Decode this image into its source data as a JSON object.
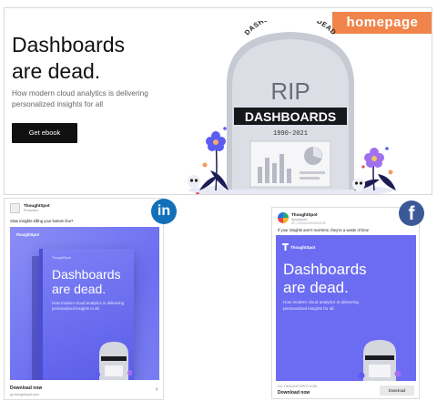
{
  "homepage": {
    "tag": "homepage",
    "headline_line1": "Dashboards",
    "headline_line2": "are dead.",
    "subtitle": "How modern cloud analytics is delivering personalized insights for all",
    "cta": "Get ebook",
    "tombstone": {
      "arc_text": "DASHBOARDS ARE DEAD",
      "rip": "RIP",
      "name": "DASHBOARDS",
      "years": "1990-2021"
    }
  },
  "linkedin_ad": {
    "brand": "ThoughtSpot",
    "meta": "Promoted",
    "caption": "Slow insights killing your bottom line?",
    "creative_brand": "ThoughtSpot",
    "book_brand": "ThoughtSpot",
    "title_line1": "Dashboards",
    "title_line2": "are dead.",
    "subtitle": "How modern cloud analytics is delivering personalized insights to all.",
    "cta": "Download now",
    "url": "go.thoughtspot.com",
    "badge": "in"
  },
  "facebook_ad": {
    "brand": "ThoughtSpot",
    "meta": "Sponsored",
    "meta2": "ID: 2933401503440198",
    "caption": "If your insights aren't real-time, they're a waste of time",
    "creative_brand": "ThoughtSpot",
    "title_line1": "Dashboards",
    "title_line2": "are dead.",
    "subtitle": "How modern cloud analytics is delivering personalized insights for all.",
    "url": "GO.THOUGHTSPOT.COM",
    "cta": "Download now",
    "button": "Download",
    "badge": "f"
  },
  "colors": {
    "accent_orange": "#f0844a",
    "creative_purple": "#6c6cf2",
    "linkedin_blue": "#1270b9",
    "facebook_blue": "#3b5998"
  }
}
